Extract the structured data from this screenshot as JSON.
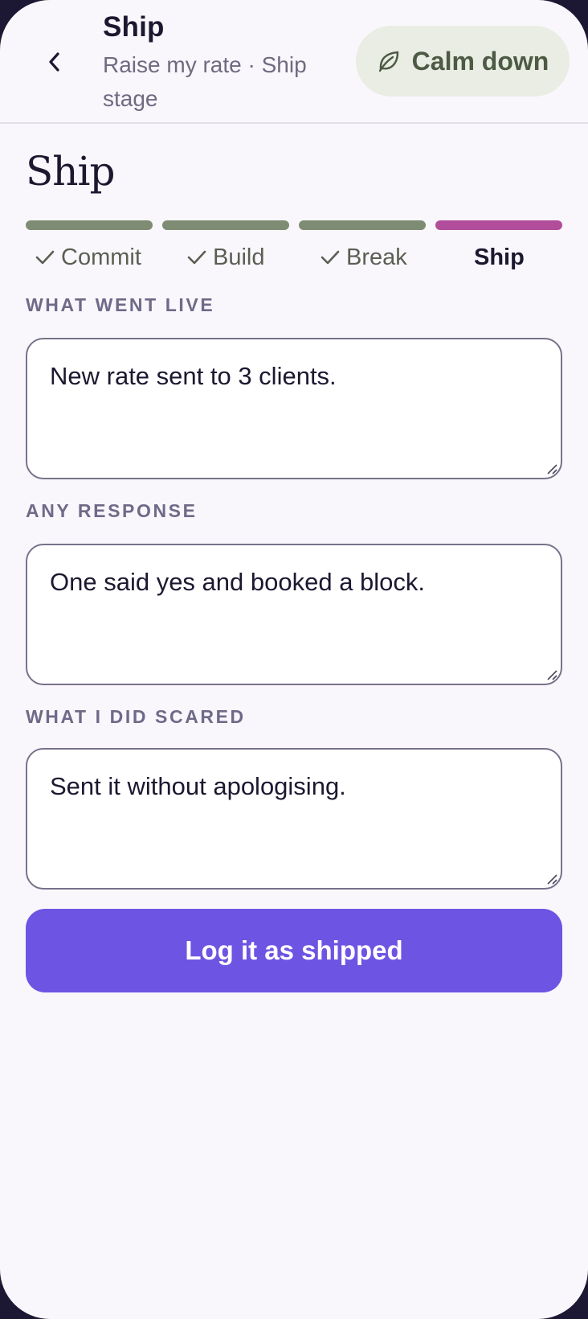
{
  "header": {
    "title": "Ship",
    "subtitle": "Raise my rate · Ship stage",
    "calm_label": "Calm down",
    "back_icon": "chevron-left-icon",
    "calm_icon": "leaf-icon"
  },
  "stage": {
    "title": "Ship"
  },
  "progress": {
    "steps": [
      {
        "label": "Commit",
        "status": "done"
      },
      {
        "label": "Build",
        "status": "done"
      },
      {
        "label": "Break",
        "status": "done"
      },
      {
        "label": "Ship",
        "status": "current"
      }
    ],
    "colors": {
      "done": "#7e8c73",
      "current": "#b24d9c"
    }
  },
  "fields": [
    {
      "label": "WHAT WENT LIVE",
      "value": "New rate sent to 3 clients."
    },
    {
      "label": "ANY RESPONSE",
      "value": "One said yes and booked a block."
    },
    {
      "label": "WHAT I DID SCARED",
      "value": "Sent it without apologising."
    }
  ],
  "submit": {
    "label": "Log it as shipped"
  },
  "colors": {
    "accent": "#6e54e3",
    "background": "#f9f7fc",
    "calm_bg": "#e9ede3"
  }
}
